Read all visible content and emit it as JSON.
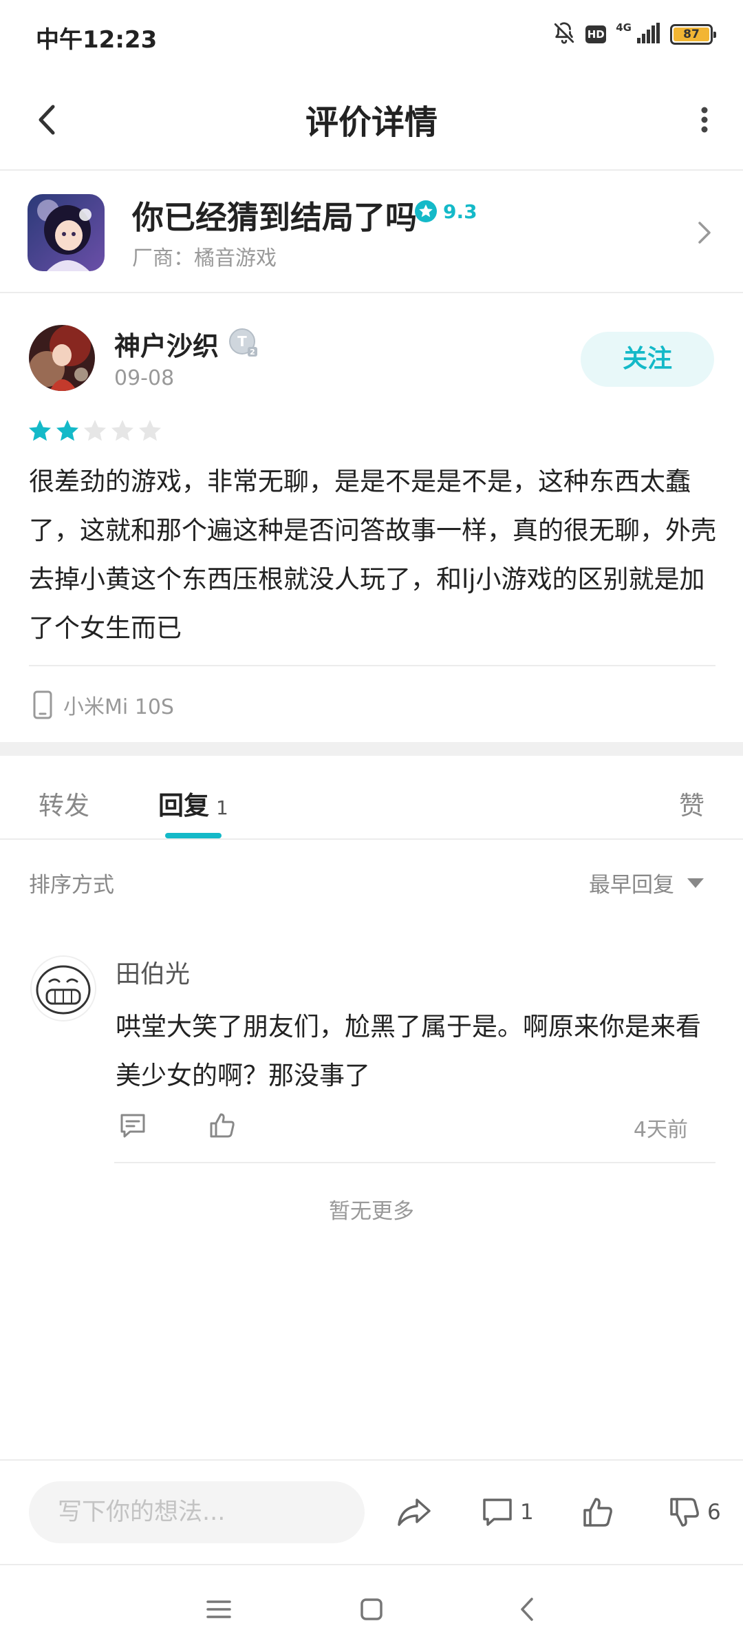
{
  "status_bar": {
    "time": "中午12:23",
    "hd_label": "HD",
    "network_label": "4G",
    "battery_level": "87"
  },
  "header": {
    "title": "评价详情"
  },
  "game": {
    "title": "你已经猜到结局了吗",
    "score": "9.3",
    "vendor": "厂商：橘音游戏"
  },
  "review": {
    "user_name": "神户沙织",
    "level_badge": "T2",
    "date": "09-08",
    "follow_label": "关注",
    "rating": 2,
    "rating_max": 5,
    "text": "很差劲的游戏，非常无聊，是是不是是不是，这种东西太蠢了，这就和那个遍这种是否问答故事一样，真的很无聊，外壳去掉小黄这个东西压根就没人玩了，和lj小游戏的区别就是加了个女生而已",
    "device": "小米Mi 10S"
  },
  "tabs": {
    "forward_label": "转发",
    "reply_label": "回复",
    "reply_count": "1",
    "like_label": "赞"
  },
  "sort": {
    "label": "排序方式",
    "selected": "最早回复"
  },
  "comment": {
    "user_name": "田伯光",
    "text": "哄堂大笑了朋友们，尬黑了属于是。啊原来你是来看美少女的啊？那没事了",
    "time": "4天前"
  },
  "footer_note": "暂无更多",
  "bottom_bar": {
    "input_placeholder": "写下你的想法...",
    "reply_count": "1",
    "dislike_count": "6"
  },
  "colors": {
    "accent": "#14b9c8",
    "star_empty": "#e6e6e6",
    "divider": "#ececec"
  }
}
